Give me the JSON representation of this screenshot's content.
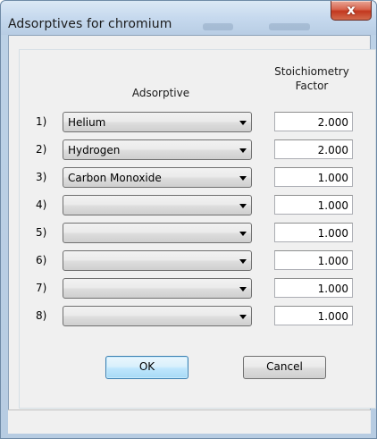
{
  "window": {
    "title": "Adsorptives for chromium",
    "close_glyph": "x"
  },
  "columns": {
    "adsorptive": "Adsorptive",
    "factor_line1": "Stoichiometry",
    "factor_line2": "Factor"
  },
  "rows": [
    {
      "index": "1)",
      "adsorptive": "Helium",
      "factor": "2.000"
    },
    {
      "index": "2)",
      "adsorptive": "Hydrogen",
      "factor": "2.000"
    },
    {
      "index": "3)",
      "adsorptive": "Carbon Monoxide",
      "factor": "1.000"
    },
    {
      "index": "4)",
      "adsorptive": "",
      "factor": "1.000"
    },
    {
      "index": "5)",
      "adsorptive": "",
      "factor": "1.000"
    },
    {
      "index": "6)",
      "adsorptive": "",
      "factor": "1.000"
    },
    {
      "index": "7)",
      "adsorptive": "",
      "factor": "1.000"
    },
    {
      "index": "8)",
      "adsorptive": "",
      "factor": "1.000"
    }
  ],
  "buttons": {
    "ok": "OK",
    "cancel": "Cancel"
  }
}
